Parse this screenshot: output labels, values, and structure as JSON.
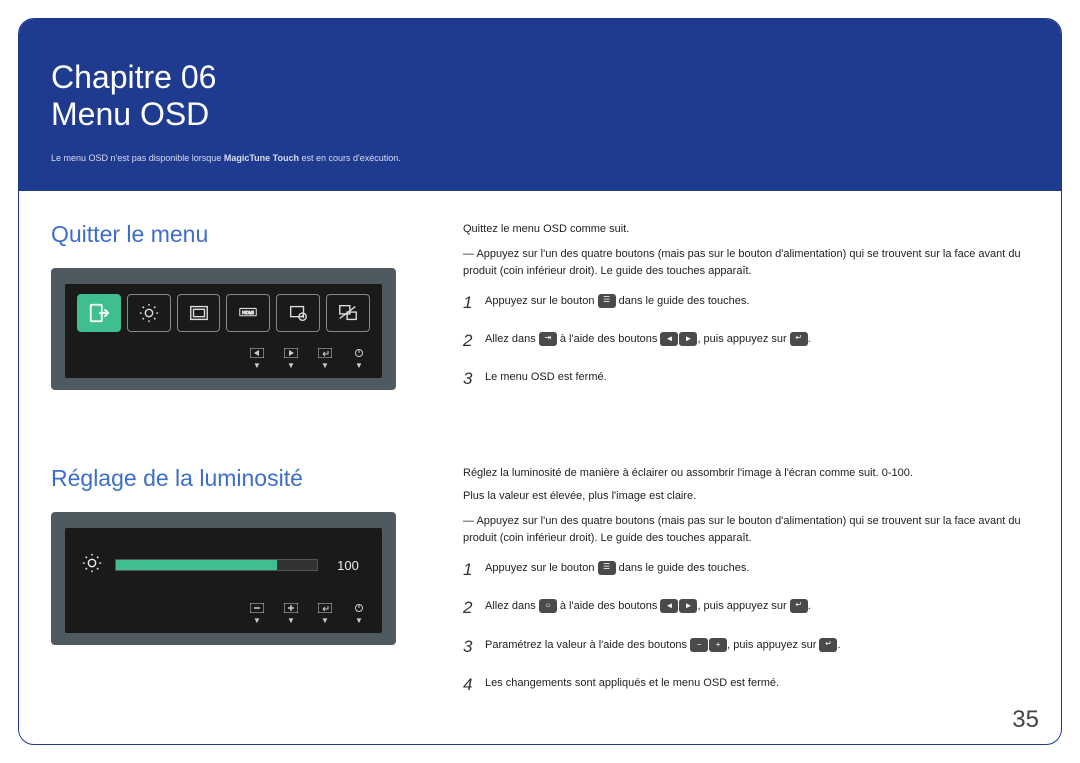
{
  "hero": {
    "chapter": "Chapitre 06",
    "title": "Menu OSD",
    "note_prefix": "Le menu OSD n'est pas disponible lorsque ",
    "note_bold": "MagicTune Touch",
    "note_suffix": " est en cours d'exécution."
  },
  "section1": {
    "title": "Quitter le menu",
    "intro": "Quittez le menu OSD comme suit.",
    "dash": "Appuyez sur l'un des quatre boutons (mais pas sur le bouton d'alimentation) qui se trouvent sur la face avant du produit (coin inférieur droit). Le guide des touches apparaît.",
    "steps": {
      "s1a": "Appuyez sur le bouton ",
      "s1b": " dans le guide des touches.",
      "s2a": "Allez dans ",
      "s2b": " à l'aide des boutons ",
      "s2c": ", puis appuyez sur ",
      "s2d": ".",
      "s3": "Le menu OSD est fermé."
    }
  },
  "section2": {
    "title": "Réglage de la luminosité",
    "intro": "Réglez la luminosité de manière à éclairer ou assombrir l'image à l'écran comme suit. 0-100.",
    "intro2": "Plus la valeur est élevée, plus l'image est claire.",
    "dash": "Appuyez sur l'un des quatre boutons (mais pas sur le bouton d'alimentation) qui se trouvent sur la face avant du produit (coin inférieur droit). Le guide des touches apparaît.",
    "steps": {
      "s1a": "Appuyez sur le bouton ",
      "s1b": " dans le guide des touches.",
      "s2a": "Allez dans ",
      "s2b": " à l'aide des boutons ",
      "s2c": ", puis appuyez sur ",
      "s2d": ".",
      "s3a": "Paramétrez la valeur à l'aide des boutons ",
      "s3b": ", puis appuyez sur ",
      "s3c": ".",
      "s4": "Les changements sont appliqués et le menu OSD est fermé."
    },
    "brightness_value": "100"
  },
  "page_number": "35",
  "step_nums": {
    "n1": "1",
    "n2": "2",
    "n3": "3",
    "n4": "4"
  }
}
